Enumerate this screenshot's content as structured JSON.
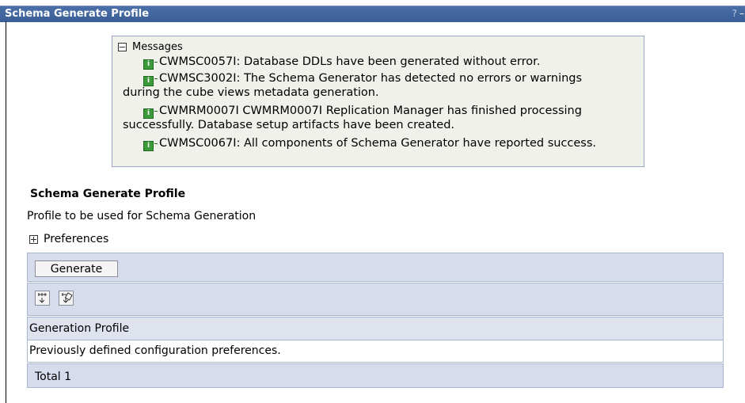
{
  "window": {
    "title": "Schema Generate Profile",
    "help_label": "?",
    "minimize_label": "–"
  },
  "messages": {
    "header": "Messages",
    "items": [
      {
        "line1": "CWMSC0057I: Database DDLs have been generated without error.",
        "line2": ""
      },
      {
        "line1": "CWMSC3002I: The Schema Generator has detected no errors or warnings",
        "line2": "during the cube views metadata generation."
      },
      {
        "line1": "CWMRM0007I CWMRM0007I Replication Manager has finished processing",
        "line2": "successfully. Database setup artifacts have been created."
      },
      {
        "line1": "CWMSC0067I: All components of Schema Generator have reported success.",
        "line2": ""
      }
    ],
    "icon": "info-icon"
  },
  "section": {
    "title": "Schema Generate Profile",
    "description": "Profile to be used for Schema Generation",
    "preferences_label": "Preferences"
  },
  "toolbar": {
    "generate_label": "Generate",
    "select_all_icon": "select-all-icon",
    "deselect_all_icon": "deselect-all-icon"
  },
  "table": {
    "column_header": "Generation Profile",
    "rows": [
      "Previously defined configuration preferences."
    ],
    "total_label": "Total 1"
  },
  "colors": {
    "titlebar": "#395d95",
    "panel": "#d7dced",
    "message_bg": "#f1f1ec",
    "info_icon": "#3c9a3c"
  }
}
